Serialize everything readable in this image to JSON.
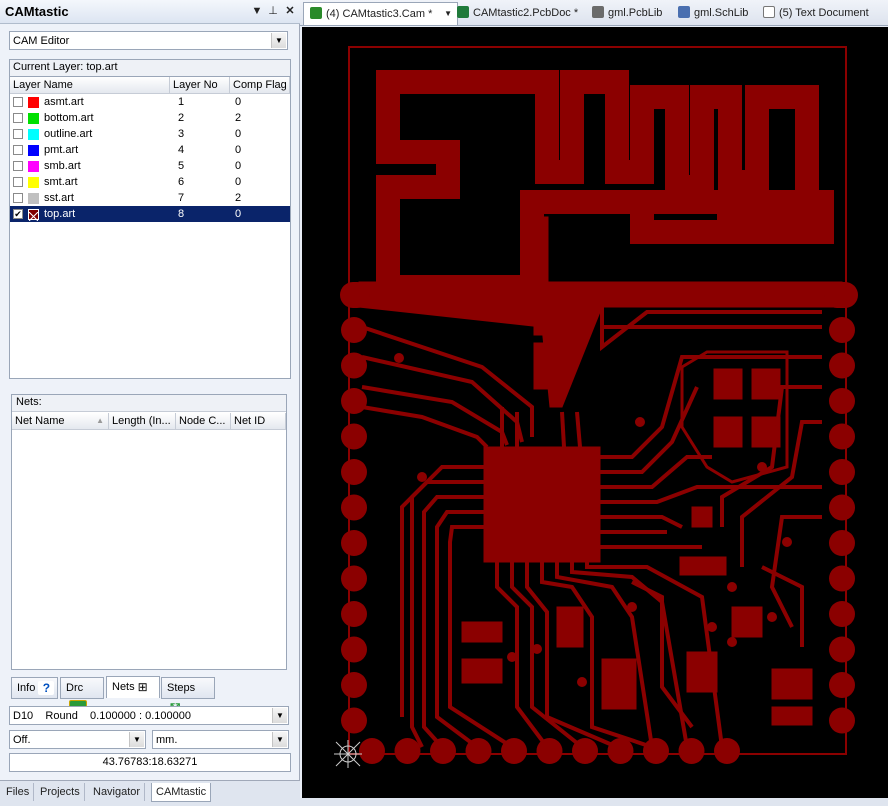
{
  "panel": {
    "title": "CAMtastic",
    "editor_select": "CAM Editor",
    "current_layer_label": "Current Layer: top.art",
    "layer_columns": [
      "Layer Name",
      "Layer No",
      "Comp Flag"
    ],
    "layers": [
      {
        "name": "asmt.art",
        "no": "1",
        "flag": "0",
        "color": "#ff0000",
        "checked": false,
        "selected": false
      },
      {
        "name": "bottom.art",
        "no": "2",
        "flag": "2",
        "color": "#00e000",
        "checked": false,
        "selected": false
      },
      {
        "name": "outline.art",
        "no": "3",
        "flag": "0",
        "color": "#00ffff",
        "checked": false,
        "selected": false
      },
      {
        "name": "pmt.art",
        "no": "4",
        "flag": "0",
        "color": "#0000ff",
        "checked": false,
        "selected": false
      },
      {
        "name": "smb.art",
        "no": "5",
        "flag": "0",
        "color": "#ff00ff",
        "checked": false,
        "selected": false
      },
      {
        "name": "smt.art",
        "no": "6",
        "flag": "0",
        "color": "#ffff00",
        "checked": false,
        "selected": false
      },
      {
        "name": "sst.art",
        "no": "7",
        "flag": "2",
        "color": "#c0c0c0",
        "checked": false,
        "selected": false
      },
      {
        "name": "top.art",
        "no": "8",
        "flag": "0",
        "color": "#800000",
        "checked": true,
        "selected": true
      }
    ],
    "nets_label": "Nets:",
    "net_columns": [
      "Net Name",
      "Length (In...",
      "Node C...",
      "Net ID"
    ],
    "tabs": [
      "Info",
      "Drc",
      "Nets",
      "Steps"
    ],
    "active_tab": "Nets",
    "aperture_select": "D10    Round    0.100000 : 0.100000",
    "mode_select": "Off.",
    "units_select": "mm.",
    "coordinates": "43.76783:18.63271"
  },
  "panel_tabs": [
    "Files",
    "Projects",
    "Navigator",
    "CAMtastic"
  ],
  "active_panel_tab": "CAMtastic",
  "doc_tabs": [
    {
      "label": "(4) CAMtastic3.Cam *",
      "icon": "cam-icon",
      "active": true
    },
    {
      "label": "CAMtastic2.PcbDoc *",
      "icon": "pcb-icon",
      "active": false
    },
    {
      "label": "gml.PcbLib",
      "icon": "pcblib-icon",
      "active": false
    },
    {
      "label": "gml.SchLib",
      "icon": "schlib-icon",
      "active": false
    },
    {
      "label": "(5) Text Document",
      "icon": "text-document-icon",
      "active": false
    }
  ],
  "colors": {
    "copper": "#8b0000",
    "canvas": "#000000",
    "selection": "#0a246a"
  }
}
